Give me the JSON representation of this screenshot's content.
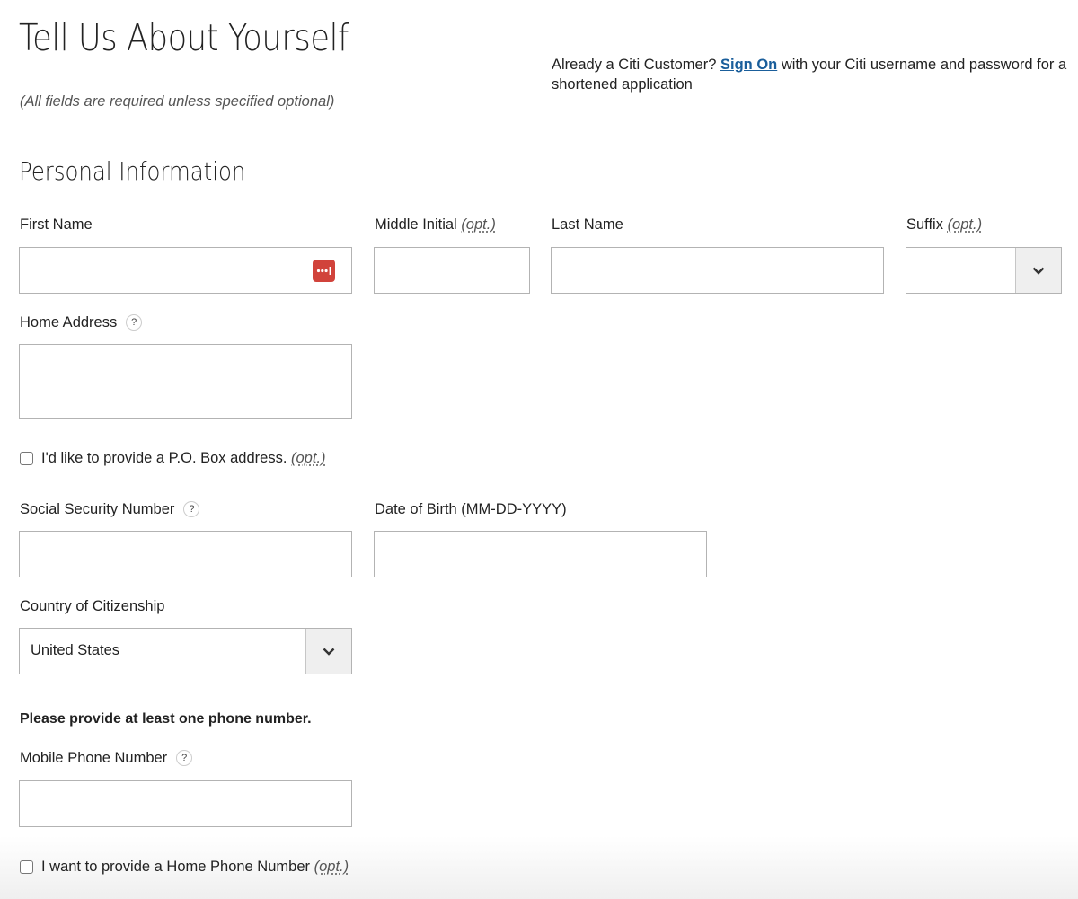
{
  "header": {
    "title": "Tell Us About Yourself",
    "required_note": "(All fields are required unless specified optional)",
    "signon_prefix": "Already a Citi Customer? ",
    "signon_link": "Sign On",
    "signon_suffix": " with your Citi username and password for a shortened application"
  },
  "section": {
    "title": "Personal Information"
  },
  "optional_marker": "(opt.)",
  "help_glyph": "?",
  "fields": {
    "first_name": {
      "label": "First Name",
      "value": "",
      "autofill_icon": "lastpass-icon"
    },
    "middle_initial": {
      "label": "Middle Initial",
      "value": ""
    },
    "last_name": {
      "label": "Last Name",
      "value": ""
    },
    "suffix": {
      "label": "Suffix",
      "value": ""
    },
    "home_address": {
      "label": "Home Address",
      "value": ""
    },
    "po_box": {
      "label": "I'd like to provide a P.O. Box address.",
      "checked": false
    },
    "ssn": {
      "label": "Social Security Number",
      "value": ""
    },
    "dob": {
      "label": "Date of Birth (MM-DD-YYYY)",
      "value": ""
    },
    "citizenship": {
      "label": "Country of Citizenship",
      "value": "United States"
    },
    "phone_note": "Please provide at least one phone number.",
    "mobile_phone": {
      "label": "Mobile Phone Number",
      "value": ""
    },
    "home_phone": {
      "label": "I want to provide a Home Phone Number",
      "checked": false
    }
  },
  "colors": {
    "link": "#1a5e9b",
    "autofill_icon": "#d1433b",
    "select_button_bg": "#efefef"
  }
}
